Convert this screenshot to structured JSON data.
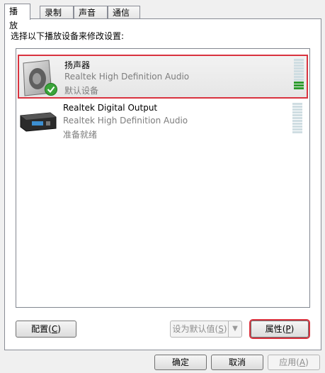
{
  "tabs": [
    {
      "label": "播放",
      "active": true
    },
    {
      "label": "录制",
      "active": false
    },
    {
      "label": "声音",
      "active": false
    },
    {
      "label": "通信",
      "active": false
    }
  ],
  "instruction": "选择以下播放设备来修改设置:",
  "devices": [
    {
      "name": "扬声器",
      "description": "Realtek High Definition Audio",
      "status": "默认设备",
      "icon": "speaker-icon",
      "badge_icon": "default-checkmark-icon",
      "selected": true,
      "level_segments_total": 11,
      "level_segments_on": 3
    },
    {
      "name": "Realtek Digital Output",
      "description": "Realtek High Definition Audio",
      "status": "准备就绪",
      "icon": "digital-output-device-icon",
      "selected": false,
      "level_segments_total": 11,
      "level_segments_on": 0
    }
  ],
  "buttons": {
    "configure": {
      "label": "配置",
      "accel": "C"
    },
    "set_default": {
      "label": "设为默认值",
      "accel": "S"
    },
    "properties": {
      "label": "属性",
      "accel": "P"
    },
    "ok": "确定",
    "cancel": "取消",
    "apply": {
      "label": "应用",
      "accel": "A"
    }
  },
  "colors": {
    "selection_outline": "#d9333f",
    "meter_on": "#2c9b2c",
    "meter_off": "#cfdde2",
    "secondary_text": "#7d7d7d"
  }
}
